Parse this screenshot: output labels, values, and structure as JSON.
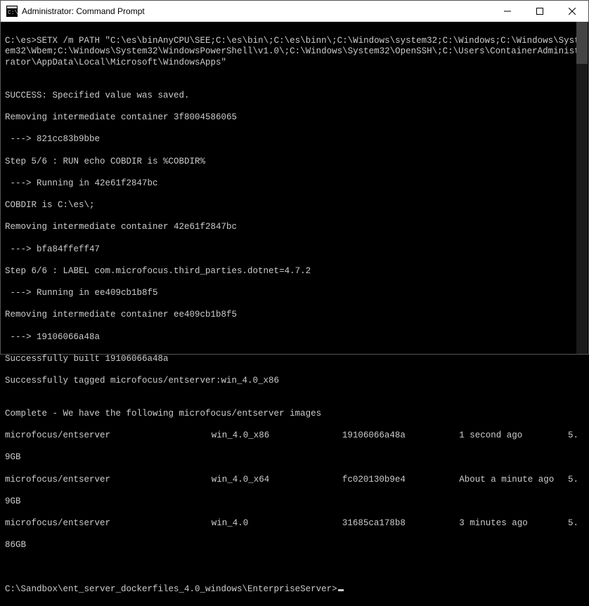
{
  "window": {
    "title": "Administrator: Command Prompt"
  },
  "terminal": {
    "prompt1": "C:\\es>",
    "command1": "SETX /m PATH \"C:\\es\\binAnyCPU\\SEE;C:\\es\\bin\\;C:\\es\\binn\\;C:\\Windows\\system32;C:\\Windows;C:\\Windows\\System32\\Wbem;C:\\Windows\\System32\\WindowsPowerShell\\v1.0\\;C:\\Windows\\System32\\OpenSSH\\;C:\\Users\\ContainerAdministrator\\AppData\\Local\\Microsoft\\WindowsApps\"",
    "lines": [
      "",
      "SUCCESS: Specified value was saved.",
      "Removing intermediate container 3f8004586065",
      " ---> 821cc83b9bbe",
      "Step 5/6 : RUN echo COBDIR is %COBDIR%",
      " ---> Running in 42e61f2847bc",
      "COBDIR is C:\\es\\;",
      "Removing intermediate container 42e61f2847bc",
      " ---> bfa84ffeff47",
      "Step 6/6 : LABEL com.microfocus.third_parties.dotnet=4.7.2",
      " ---> Running in ee409cb1b8f5",
      "Removing intermediate container ee409cb1b8f5",
      " ---> 19106066a48a",
      "Successfully built 19106066a48a",
      "Successfully tagged microfocus/entserver:win_4.0_x86",
      "",
      "Complete - We have the following microfocus/entserver images"
    ],
    "images": [
      {
        "repo": "microfocus/entserver",
        "tag": "win_4.0_x86",
        "id": "19106066a48a",
        "created": "1 second ago",
        "size": "5.9GB"
      },
      {
        "repo": "microfocus/entserver",
        "tag": "win_4.0_x64",
        "id": "fc020130b9e4",
        "created": "About a minute ago",
        "size": "5.9GB"
      },
      {
        "repo": "microfocus/entserver",
        "tag": "win_4.0",
        "id": "31685ca178b8",
        "created": "3 minutes ago",
        "size": "5.86GB"
      }
    ],
    "prompt2": "C:\\Sandbox\\ent_server_dockerfiles_4.0_windows\\EnterpriseServer>"
  }
}
